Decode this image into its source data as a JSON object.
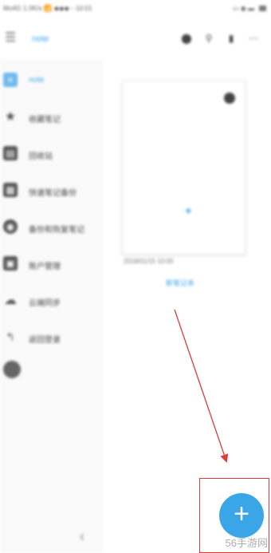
{
  "status_bar": {
    "left_text": "Mo4G 1.0K/s 📶 ◆◆◆ ◦ 10:01",
    "right_text": "▭ ◉ ▬"
  },
  "top_bar": {
    "menu_icon": "menu-toggle-icon",
    "title": "note",
    "icons": [
      "sort-icon",
      "search-icon",
      "sync-icon",
      "more-icon"
    ]
  },
  "sidebar": {
    "items": [
      {
        "label": "note",
        "icon": "notebook-icon",
        "active": true
      },
      {
        "label": "收藏笔记",
        "icon": "star-icon",
        "active": false
      },
      {
        "label": "回收站",
        "icon": "trash-icon",
        "active": false
      },
      {
        "label": "快速笔记备份",
        "icon": "backup-icon",
        "active": false
      },
      {
        "label": "备份和恢复笔记",
        "icon": "restore-icon",
        "active": false
      },
      {
        "label": "账户管理",
        "icon": "account-icon",
        "active": false
      },
      {
        "label": "云端同步",
        "icon": "cloud-icon",
        "active": false
      },
      {
        "label": "返回登录",
        "icon": "logout-icon",
        "active": false
      }
    ],
    "settings_icon": "settings-icon",
    "collapse_icon": "chevron-left-icon"
  },
  "main": {
    "card": {
      "date": "2018/01/15 10:00",
      "name": "新笔记本",
      "menu_icon": "more-dots-icon",
      "add_icon": "plus-icon"
    },
    "fab": {
      "icon": "plus-icon",
      "label": "+"
    }
  },
  "watermark": "56手游网",
  "colors": {
    "accent": "#3aa6e8",
    "annotation": "#e03b3b"
  }
}
